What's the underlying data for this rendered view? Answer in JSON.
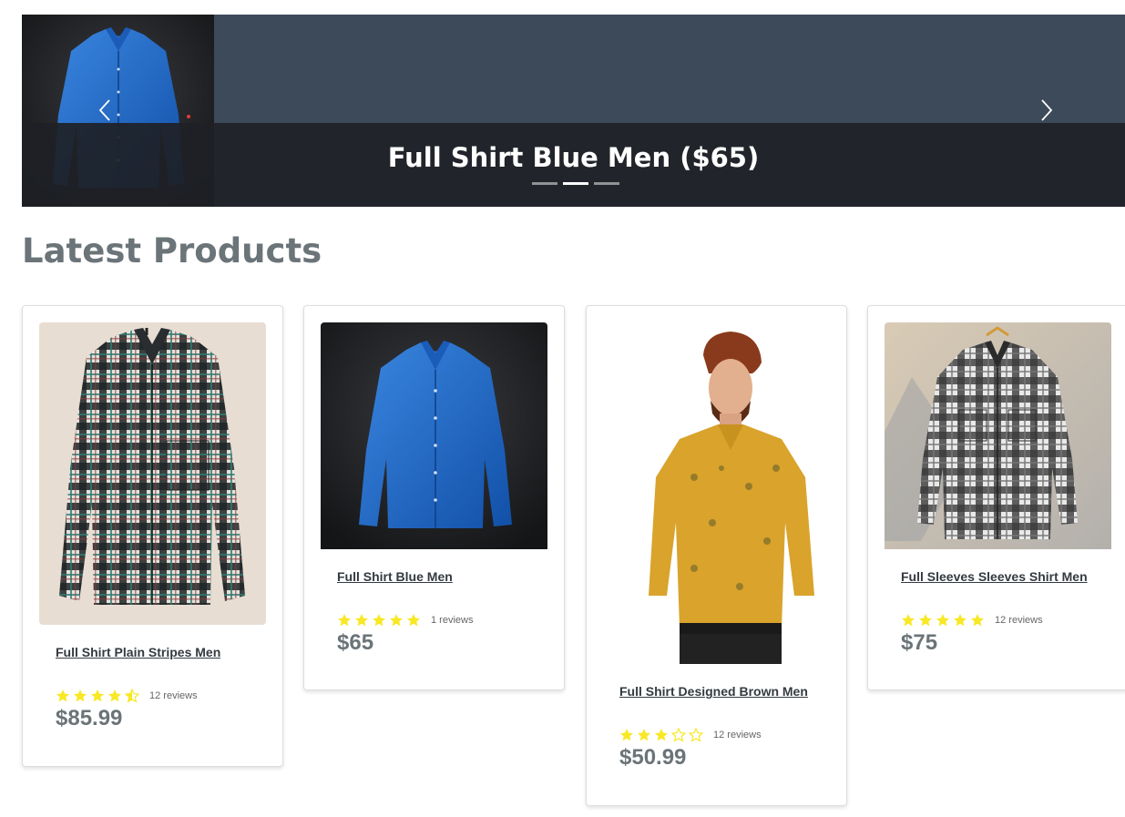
{
  "carousel": {
    "caption": "Full Shirt Blue Men ($65)",
    "indicators": [
      false,
      true,
      false
    ],
    "prev_label": "Previous",
    "next_label": "Next"
  },
  "section": {
    "title": "Latest Products"
  },
  "products": [
    {
      "title": "Full Shirt Plain Stripes Men",
      "rating": 4.5,
      "reviews": "12 reviews",
      "price": "$85.99"
    },
    {
      "title": "Full Shirt Blue Men",
      "rating": 5,
      "reviews": "1 reviews",
      "price": "$65"
    },
    {
      "title": "Full Shirt Designed Brown Men",
      "rating": 3,
      "reviews": "12 reviews",
      "price": "$50.99"
    },
    {
      "title": "Full Sleeves Sleeves Shirt Men",
      "rating": 5,
      "reviews": "12 reviews",
      "price": "$75"
    }
  ],
  "colors": {
    "star": "#f8e825",
    "carousel_bg": "#3d4a5a",
    "heading": "#6b7478"
  }
}
